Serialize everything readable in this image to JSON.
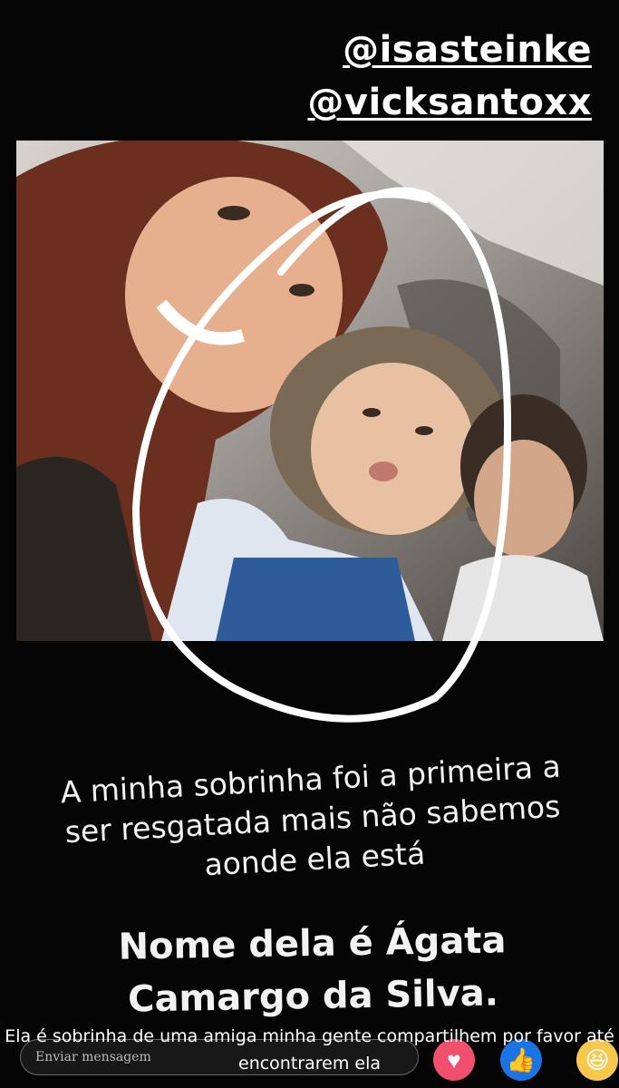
{
  "mentions": [
    "@isasteinke",
    "@vicksantoxx"
  ],
  "caption_1": "A minha sobrinha foi a primeira a ser resgatada mais não sabemos aonde ela está",
  "caption_2": "Nome dela é Ágata Camargo da Silva.",
  "comment": "Ela é sobrinha de uma amiga minha gente compartilhem por favor até encontrarem ela",
  "message_input": {
    "placeholder": "Enviar mensagem"
  },
  "reactions": [
    "love",
    "like",
    "haha"
  ],
  "colors": {
    "background": "#000000",
    "circle": "#ffffff",
    "love": "#f0506e",
    "like": "#1b74e4",
    "haha": "#f7c84b"
  }
}
